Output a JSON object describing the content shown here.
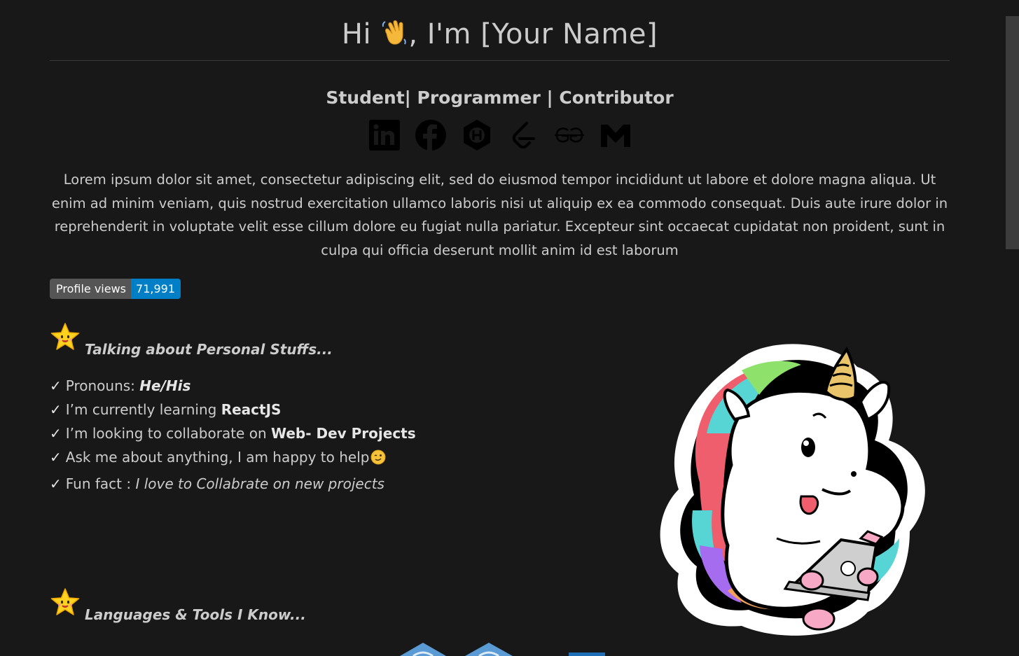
{
  "header": {
    "greeting_before": "Hi ",
    "greeting_after": ", I'm [Your Name]"
  },
  "subtitle": "Student| Programmer | Contributor",
  "socials": [
    {
      "name": "linkedin-icon"
    },
    {
      "name": "facebook-icon"
    },
    {
      "name": "hashnode-icon"
    },
    {
      "name": "leetcode-icon"
    },
    {
      "name": "geeksforgeeks-icon"
    },
    {
      "name": "gmail-icon"
    }
  ],
  "about": "Lorem ipsum dolor sit amet, consectetur adipiscing elit, sed do eiusmod tempor incididunt ut labore et dolore magna aliqua. Ut enim ad minim veniam, quis nostrud exercitation ullamco laboris nisi ut aliquip ex ea commodo consequat. Duis aute irure dolor in reprehenderit in voluptate velit esse cillum dolore eu fugiat nulla pariatur. Excepteur sint occaecat cupidatat non proident, sunt in culpa qui officia deserunt mollit anim id est laborum",
  "badge": {
    "label": "Profile views",
    "value": "71,991",
    "label_color": "#555555",
    "value_color": "#007ec6"
  },
  "personal": {
    "heading": "Talking about Personal Stuffs...",
    "check": "✓",
    "items": [
      {
        "prefix": "Pronouns: ",
        "strong": "He/His"
      },
      {
        "prefix": "I’m currently learning ",
        "strong": "ReactJS"
      },
      {
        "prefix": "I’m looking to collaborate on ",
        "strong": "Web- Dev Projects"
      },
      {
        "prefix": "Ask me about anything, I am happy to help",
        "strong": ""
      },
      {
        "prefix": "Fun fact : ",
        "italic": "I love to Collabrate on new projects"
      }
    ]
  },
  "languages": {
    "heading": "Languages & Tools I Know..."
  },
  "colors": {
    "background": "#181818",
    "text": "#cccccc"
  }
}
